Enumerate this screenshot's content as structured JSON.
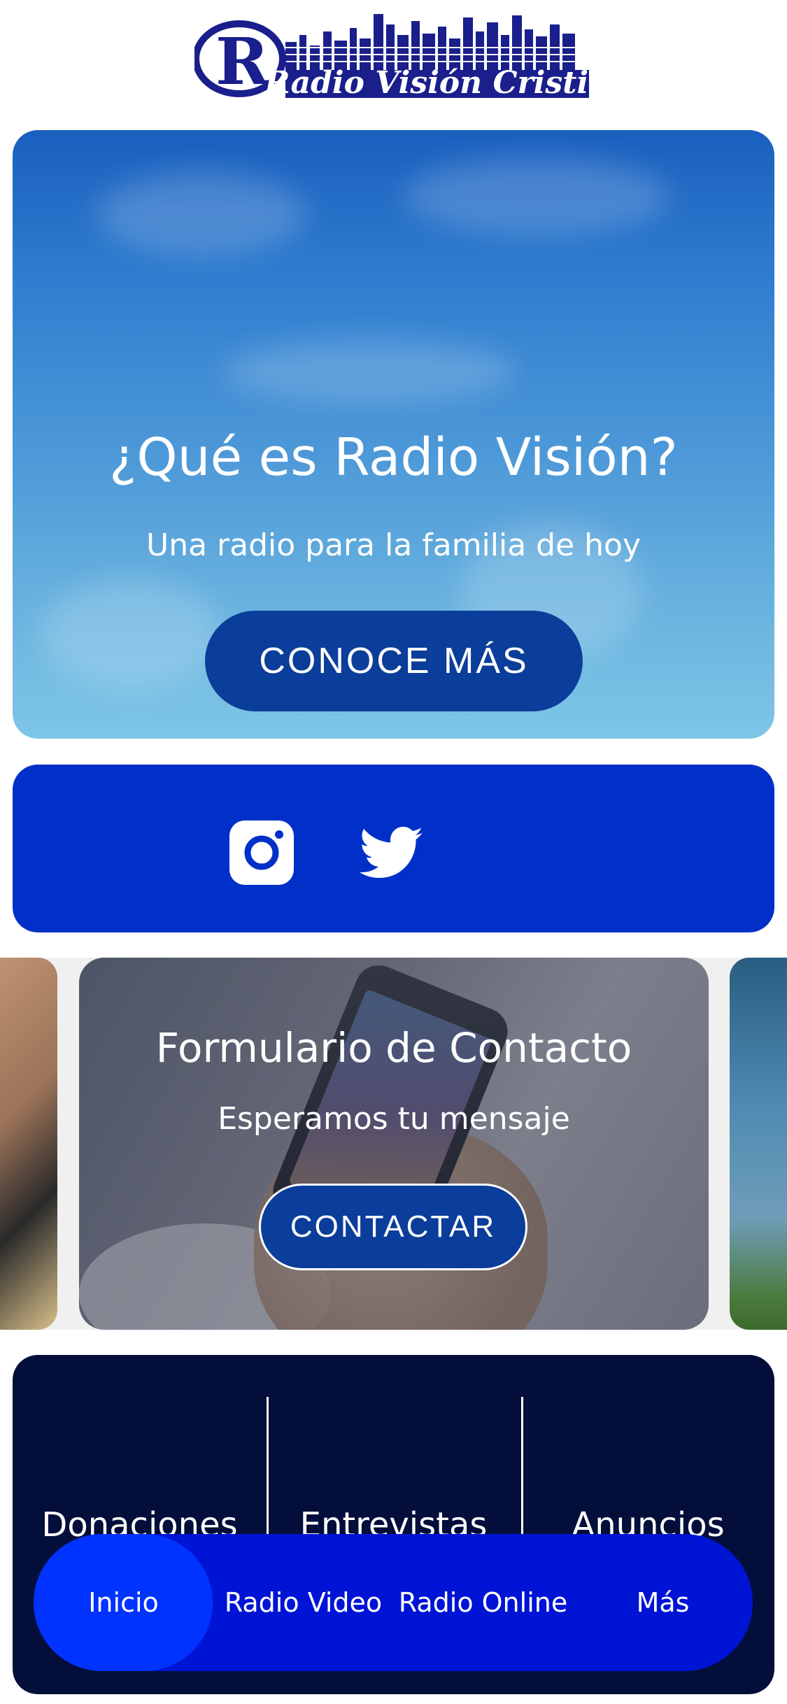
{
  "header": {
    "logo_text": "Radio Visión Cristiana",
    "logo_letter": "R"
  },
  "hero": {
    "title": "¿Qué es Radio Visión?",
    "subtitle": "Una radio para la familia de hoy",
    "button_label": "CONOCE MÁS"
  },
  "social": {
    "icons": [
      "instagram-icon",
      "twitter-icon"
    ]
  },
  "carousel": {
    "active_slide": {
      "title": "Formulario de Contacto",
      "subtitle": "Esperamos tu mensaje",
      "button_label": "CONTACTAR"
    }
  },
  "panel": {
    "links": [
      "Donaciones",
      "Entrevistas",
      "Anuncios"
    ]
  },
  "bottom_nav": {
    "items": [
      "Inicio",
      "Radio Video",
      "Radio Online",
      "Más"
    ],
    "active": "Inicio"
  },
  "colors": {
    "social_bg": "#0030c8",
    "hero_button": "#0b3d9a",
    "panel_bg": "#040e3a",
    "nav_bg": "#0014d6",
    "nav_active": "#0033ff",
    "logo_blue": "#1a1f8c"
  }
}
